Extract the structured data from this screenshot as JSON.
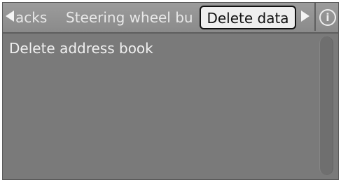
{
  "tabs": {
    "partial_label": "acks",
    "steering_label": "Steering wheel bu",
    "active_label": "Delete data"
  },
  "icons": {
    "left_arrow": "arrow-left-icon",
    "right_arrow": "arrow-right-icon",
    "info": "info-icon",
    "info_glyph": "i"
  },
  "content": {
    "items": [
      {
        "label": "Delete address book"
      }
    ]
  }
}
